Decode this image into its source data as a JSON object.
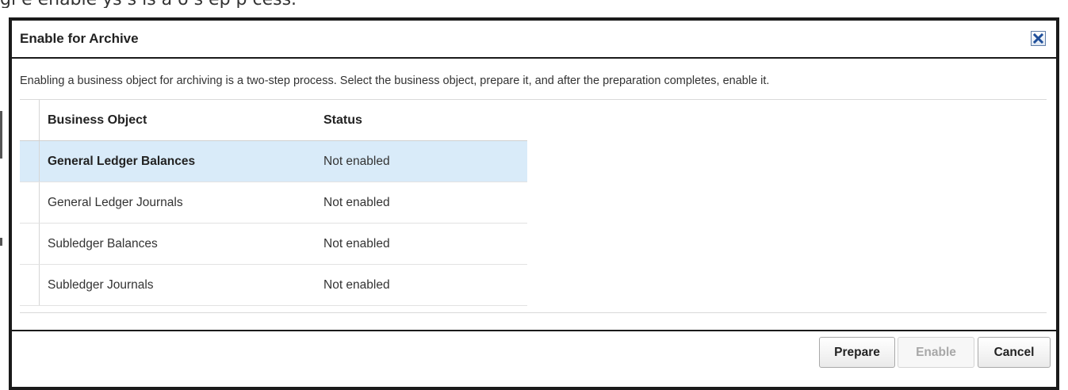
{
  "background": {
    "clipped_text": "gi e enable ys s is a o s ep p cess."
  },
  "dialog": {
    "title": "Enable for Archive",
    "close_label": "Close",
    "instructions": "Enabling a business object for archiving is a two-step process. Select the business object, prepare it, and after the preparation completes, enable it.",
    "columns": [
      "Business Object",
      "Status"
    ],
    "rows": [
      {
        "business_object": "General Ledger Balances",
        "status": "Not enabled",
        "selected": true
      },
      {
        "business_object": "General Ledger Journals",
        "status": "Not enabled",
        "selected": false
      },
      {
        "business_object": "Subledger Balances",
        "status": "Not enabled",
        "selected": false
      },
      {
        "business_object": "Subledger Journals",
        "status": "Not enabled",
        "selected": false
      }
    ],
    "buttons": {
      "prepare": "Prepare",
      "enable": "Enable",
      "cancel": "Cancel"
    }
  },
  "colors": {
    "selected_row": "#d9ebf9",
    "border": "#1a1a1a",
    "close_icon": "#1f4f9a"
  },
  "icons": {
    "close": "close-icon"
  }
}
